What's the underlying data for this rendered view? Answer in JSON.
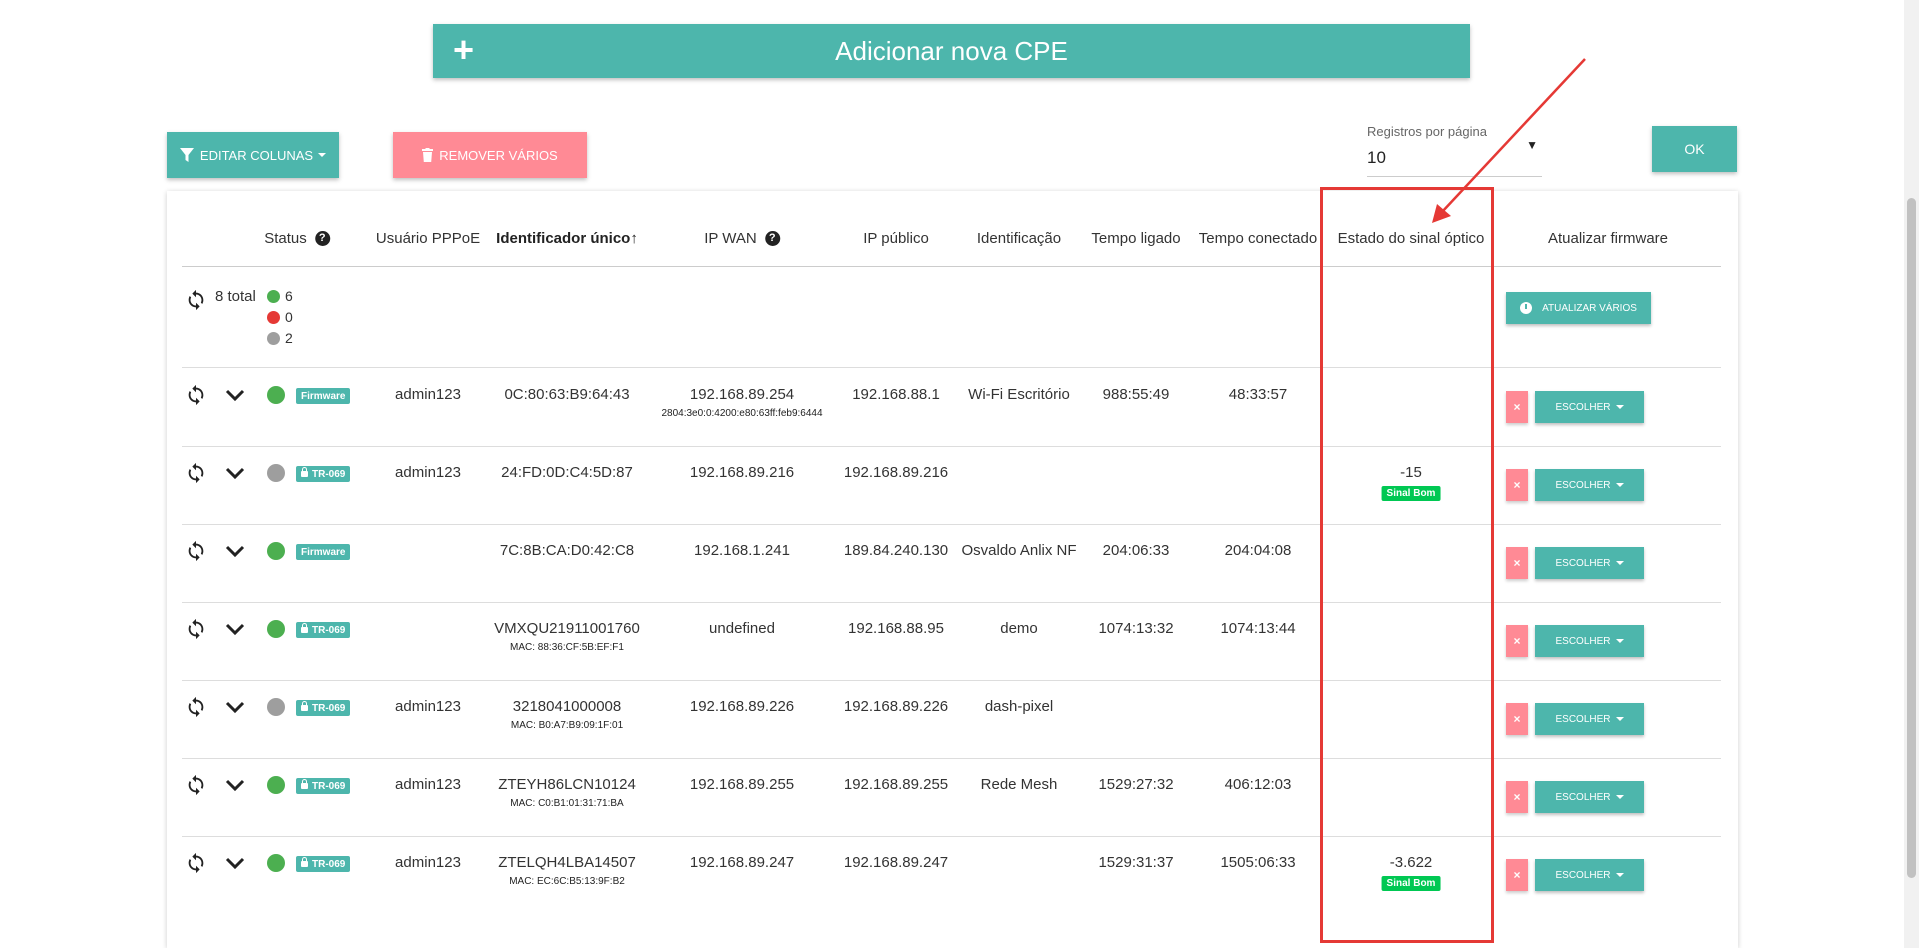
{
  "header": {
    "add_cpe_label": "Adicionar nova CPE",
    "plus_icon": "plus-icon"
  },
  "toolbar": {
    "edit_columns_label": "EDITAR COLUNAS",
    "remove_many_label": "REMOVER VÁRIOS",
    "per_page_label": "Registros por página",
    "per_page_value": "10",
    "ok_label": "OK"
  },
  "table": {
    "columns": [
      "Status",
      "Usuário PPPoE",
      "Identificador único↑",
      "IP WAN",
      "IP público",
      "Identificação",
      "Tempo ligado",
      "Tempo conectado",
      "Estado do sinal óptico",
      "Atualizar firmware"
    ],
    "summary": {
      "total_label": "8 total",
      "online_count": "6",
      "offline_count": "0",
      "unknown_count": "2",
      "update_many_label": "ATUALIZAR VÁRIOS"
    },
    "choose_label": "ESCOLHER",
    "remove_label": "×",
    "rows": [
      {
        "status": "green",
        "badge": "Firmware",
        "user": "admin123",
        "id": "0C:80:63:B9:64:43",
        "id_sub": "",
        "wan": "192.168.89.254",
        "wan_sub": "2804:3e0:0:4200:e80:63ff:feb9:6444",
        "public_ip": "192.168.88.1",
        "ident": "Wi-Fi Escritório",
        "uptime": "988:55:49",
        "conntime": "48:33:57",
        "signal": "",
        "signal_badge": ""
      },
      {
        "status": "gray",
        "badge": "TR-069",
        "user": "admin123",
        "id": "24:FD:0D:C4:5D:87",
        "id_sub": "",
        "wan": "192.168.89.216",
        "wan_sub": "",
        "public_ip": "192.168.89.216",
        "ident": "",
        "uptime": "",
        "conntime": "",
        "signal": "-15",
        "signal_badge": "Sinal Bom"
      },
      {
        "status": "green",
        "badge": "Firmware",
        "user": "",
        "id": "7C:8B:CA:D0:42:C8",
        "id_sub": "",
        "wan": "192.168.1.241",
        "wan_sub": "",
        "public_ip": "189.84.240.130",
        "ident": "Osvaldo Anlix NF",
        "uptime": "204:06:33",
        "conntime": "204:04:08",
        "signal": "",
        "signal_badge": ""
      },
      {
        "status": "green",
        "badge": "TR-069",
        "user": "",
        "id": "VMXQU21911001760",
        "id_sub": "MAC: 88:36:CF:5B:EF:F1",
        "wan": "undefined",
        "wan_sub": "",
        "public_ip": "192.168.88.95",
        "ident": "demo",
        "uptime": "1074:13:32",
        "conntime": "1074:13:44",
        "signal": "",
        "signal_badge": ""
      },
      {
        "status": "gray",
        "badge": "TR-069",
        "user": "admin123",
        "id": "3218041000008",
        "id_sub": "MAC: B0:A7:B9:09:1F:01",
        "wan": "192.168.89.226",
        "wan_sub": "",
        "public_ip": "192.168.89.226",
        "ident": "dash-pixel",
        "uptime": "",
        "conntime": "",
        "signal": "",
        "signal_badge": ""
      },
      {
        "status": "green",
        "badge": "TR-069",
        "user": "admin123",
        "id": "ZTEYH86LCN10124",
        "id_sub": "MAC: C0:B1:01:31:71:BA",
        "wan": "192.168.89.255",
        "wan_sub": "",
        "public_ip": "192.168.89.255",
        "ident": "Rede Mesh",
        "uptime": "1529:27:32",
        "conntime": "406:12:03",
        "signal": "",
        "signal_badge": ""
      },
      {
        "status": "green",
        "badge": "TR-069",
        "user": "admin123",
        "id": "ZTELQH4LBA14507",
        "id_sub": "MAC: EC:6C:B5:13:9F:B2",
        "wan": "192.168.89.247",
        "wan_sub": "",
        "public_ip": "192.168.89.247",
        "ident": "",
        "uptime": "1529:31:37",
        "conntime": "1505:06:33",
        "signal": "-3.622",
        "signal_badge": "Sinal Bom"
      }
    ]
  },
  "colors": {
    "accent": "#4db6ac",
    "danger": "#ff8a95",
    "online": "#4caf50",
    "offline": "#e53935",
    "unknown": "#9e9e9e",
    "signal_good": "#00c853",
    "annotation": "#e53935"
  }
}
